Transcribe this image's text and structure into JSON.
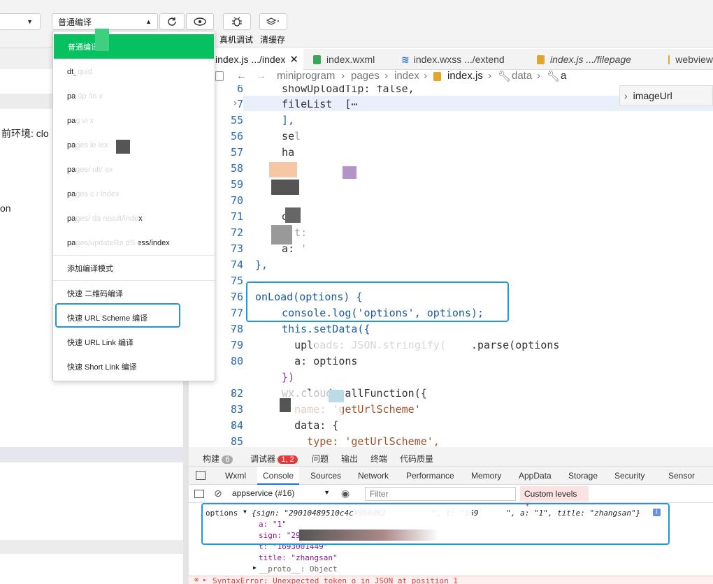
{
  "toolbar": {
    "compile_mode": "普通编译",
    "real_debug": "真机调试",
    "clear_cache": "清缓存"
  },
  "compile_menu": {
    "items": [
      "普通编译",
      "dt_quid",
      "pa    0p    /in  x",
      "pag        vi      x",
      "pages   le         lex",
      "pages/          ult/   ex",
      "pages    c          r  index",
      "pages/     da         result/index",
      "pages/updateRe    dS   ess/index"
    ],
    "add_mode": "添加编译模式",
    "quick": [
      "快速 二维码编译",
      "快速 URL Scheme 编译",
      "快速 URL Link 编译",
      "快速 Short Link 编译"
    ]
  },
  "left_panel": {
    "env_text": "前环境: clo",
    "on_text": "on"
  },
  "editor_tabs": [
    {
      "label": "index.js  .../index",
      "active": true,
      "closable": true
    },
    {
      "label": "index.wxml",
      "active": false
    },
    {
      "label": "index.wxss   .../extend",
      "active": false
    },
    {
      "label": "index.js  .../filepage",
      "active": false
    },
    {
      "label": "webview",
      "active": false
    }
  ],
  "breadcrumb": {
    "parts": [
      "miniprogram",
      "pages",
      "index",
      "index.js",
      "data",
      "a"
    ]
  },
  "outline": {
    "item": "imageUrl"
  },
  "code": {
    "l6": "  showUploadTip: false,",
    "l7": "  fileList  [⋯",
    "l55": "  ],",
    "l56": "  sel",
    "l57": "  ha",
    "l58": "  j",
    "l59": "  t",
    "l70": "",
    "l71": "  or",
    "l72": "    t:",
    "l73": "  a: '",
    "l74": "},",
    "l76": "onLoad(options) {",
    "l77": "  console.log('options', options);",
    "l78": "  this.setData({",
    "l79": "    uploads: JSON.stringify(    .parse(options",
    "l80": "    a: options",
    "l81": "  })",
    "l82": "  wx.cloud.callFunction({",
    "l83": "    name: 'getUrlScheme'",
    "l84": "    data: {",
    "l85": "      type: 'getUrlScheme',"
  },
  "line_numbers": [
    "6",
    "7",
    "55",
    "56",
    "57",
    "58",
    "59",
    "70",
    "71",
    "72",
    "73",
    "74",
    "75",
    "76",
    "77",
    "78",
    "79",
    "80",
    "82",
    "83",
    "84",
    "85"
  ],
  "devtools": {
    "tabs": [
      {
        "label": "构建",
        "badge": "6"
      },
      {
        "label": "调试器",
        "badge": "1, 2"
      },
      {
        "label": "问题"
      },
      {
        "label": "输出"
      },
      {
        "label": "终端"
      },
      {
        "label": "代码质量"
      }
    ],
    "subtabs": [
      "Wxml",
      "Console",
      "Sources",
      "Network",
      "Performance",
      "Memory",
      "AppData",
      "Storage",
      "Security",
      "Sensor"
    ],
    "context": "appservice (#16)",
    "filter_placeholder": "Filter",
    "levels": "Custom levels",
    "log": {
      "label": "options",
      "summary": "{sign: \"29010489510c4c49b0d82          \", t: \"169      \", a: \"1\", title: \"zhangsan\"}",
      "a": "a: \"1\"",
      "sign": "sign: \"29010489510c4c49b0d82918",
      "t": "t: \"1693001449\"",
      "title": "title: \"zhangsan\"",
      "proto": "__proto__: Object",
      "error": "SyntaxError: Unexpected token o in JSON at position 1"
    }
  }
}
